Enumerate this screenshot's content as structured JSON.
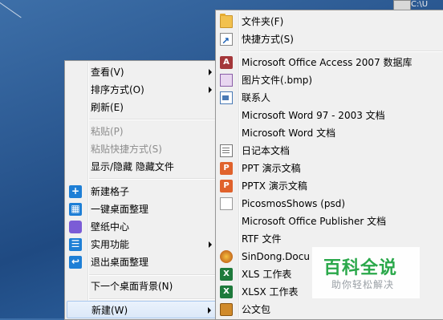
{
  "desktop": {
    "corner_text": "C:\\U"
  },
  "context_menu": {
    "items": [
      {
        "label": "查看(V)",
        "submenu": true
      },
      {
        "label": "排序方式(O)",
        "submenu": true
      },
      {
        "label": "刷新(E)"
      },
      {
        "label": "粘贴(P)",
        "disabled": true
      },
      {
        "label": "粘贴快捷方式(S)",
        "disabled": true
      },
      {
        "label": "显示/隐藏 隐藏文件"
      },
      {
        "label": "新建格子",
        "icon": "plus-icon"
      },
      {
        "label": "一键桌面整理",
        "icon": "layout-icon"
      },
      {
        "label": "壁纸中心",
        "icon": "cube-icon"
      },
      {
        "label": "实用功能",
        "icon": "list-icon",
        "submenu": true
      },
      {
        "label": "退出桌面整理",
        "icon": "exit-icon"
      },
      {
        "label": "下一个桌面背景(N)"
      },
      {
        "label": "新建(W)",
        "submenu": true,
        "highlighted": true
      }
    ]
  },
  "new_submenu": {
    "items": [
      {
        "label": "文件夹(F)",
        "icon": "folder-icon"
      },
      {
        "label": "快捷方式(S)",
        "icon": "shortcut-icon"
      },
      {
        "label": "Microsoft Office Access 2007 数据库",
        "icon": "access-icon"
      },
      {
        "label": "图片文件(.bmp)",
        "icon": "bitmap-icon"
      },
      {
        "label": "联系人",
        "icon": "contact-icon"
      },
      {
        "label": "Microsoft Word 97 - 2003 文档",
        "icon": "blank-document-icon"
      },
      {
        "label": "Microsoft Word 文档",
        "icon": "blank-document-icon"
      },
      {
        "label": "日记本文档",
        "icon": "journal-icon"
      },
      {
        "label": "PPT 演示文稿",
        "icon": "ppt-icon"
      },
      {
        "label": "PPTX 演示文稿",
        "icon": "pptx-icon"
      },
      {
        "label": "PicosmosShows (psd)",
        "icon": "blank-document-icon"
      },
      {
        "label": "Microsoft Office Publisher 文档",
        "icon": "blank-document-icon"
      },
      {
        "label": "RTF 文件",
        "icon": "blank-document-icon"
      },
      {
        "label": "SinDong.Docu",
        "icon": "sindong-icon"
      },
      {
        "label": "XLS 工作表",
        "icon": "xls-icon"
      },
      {
        "label": "XLSX 工作表",
        "icon": "xlsx-icon"
      },
      {
        "label": "公文包",
        "icon": "briefcase-icon"
      }
    ]
  },
  "watermark": {
    "title": "百科全说",
    "subtitle": "助你轻松解决"
  },
  "colors": {
    "menu_bg": "#f0f0f0",
    "highlight": "#dbe8f8",
    "watermark_green": "#2aa84a"
  }
}
